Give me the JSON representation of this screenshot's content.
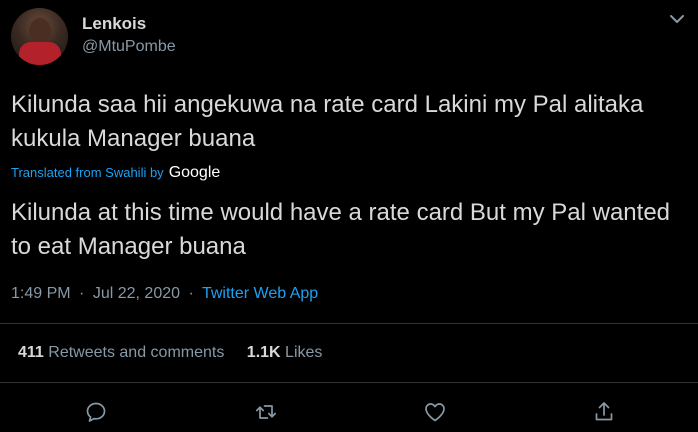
{
  "author": {
    "display_name": "Lenkois",
    "handle": "@MtuPombe",
    "avatar_icon": "profile-photo"
  },
  "tweet": {
    "original_text": "Kilunda saa hii angekuwa na rate card Lakini my Pal alitaka kukula Manager buana",
    "translated_from": "Translated from Swahili by",
    "translator": "Google",
    "translated_text": "Kilunda at this time would have a rate card But my Pal wanted to eat Manager buana",
    "time": "1:49 PM",
    "separator": "·",
    "date": "Jul 22, 2020",
    "source": "Twitter Web App"
  },
  "stats": {
    "retweets_count": "411",
    "retweets_label": "Retweets and comments",
    "likes_count": "1.1K",
    "likes_label": "Likes"
  },
  "actions": [
    {
      "name": "reply",
      "icon": "reply-icon"
    },
    {
      "name": "retweet",
      "icon": "retweet-icon"
    },
    {
      "name": "like",
      "icon": "heart-icon"
    },
    {
      "name": "share",
      "icon": "share-icon"
    }
  ],
  "colors": {
    "background": "#000000",
    "text": "#d9d9d9",
    "secondary": "#8899a6",
    "accent": "#1da1f2",
    "divider": "#2f3336"
  }
}
